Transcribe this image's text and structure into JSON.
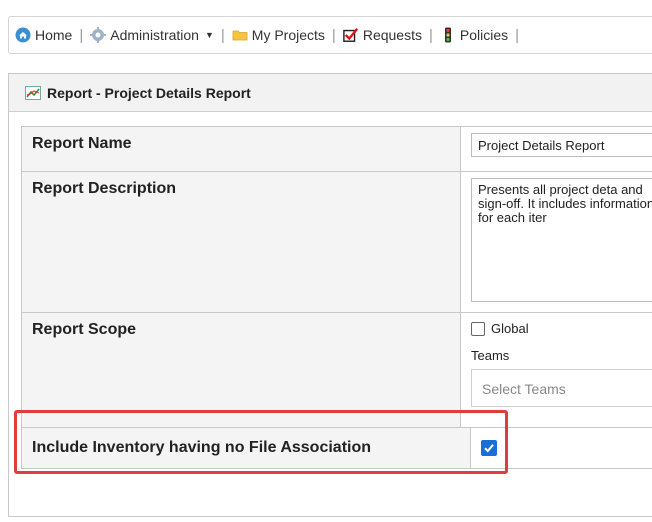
{
  "nav": {
    "items": [
      {
        "label": "Home",
        "icon": "home-icon"
      },
      {
        "label": "Administration",
        "icon": "gear-icon",
        "has_dropdown": true
      },
      {
        "label": "My Projects",
        "icon": "folder-icon"
      },
      {
        "label": "Requests",
        "icon": "checkbox-icon"
      },
      {
        "label": "Policies",
        "icon": "traffic-light-icon"
      }
    ]
  },
  "panel": {
    "title": "Report - Project Details Report"
  },
  "form": {
    "report_name": {
      "label": "Report Name",
      "value": "Project Details Report"
    },
    "report_description": {
      "label": "Report Description",
      "value": "Presents all project deta and sign-off. It includes information for each iter"
    },
    "report_scope": {
      "label": "Report Scope",
      "global_label": "Global",
      "global_checked": false,
      "teams_label": "Teams",
      "teams_placeholder": "Select Teams"
    },
    "include_inventory": {
      "label": "Include Inventory having no File Association",
      "checked": true
    }
  },
  "colors": {
    "highlight": "#e23d3d",
    "checkbox": "#1a6fd6"
  }
}
